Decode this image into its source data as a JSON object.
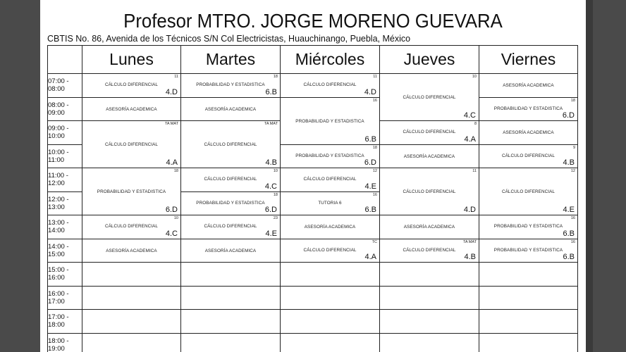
{
  "title": "Profesor MTRO. JORGE MORENO GUEVARA",
  "address": "CBTIS No. 86, Avenida de los Técnicos S/N Col Electricistas, Huauchinango, Puebla, México",
  "days": [
    "Lunes",
    "Martes",
    "Miércoles",
    "Jueves",
    "Viernes"
  ],
  "times": [
    "07:00 - 08:00",
    "08:00 - 09:00",
    "09:00 - 10:00",
    "10:00 - 11:00",
    "11:00 - 12:00",
    "12:00 - 13:00",
    "13:00 - 14:00",
    "14:00 - 15:00",
    "15:00 - 16:00",
    "16:00 - 17:00",
    "17:00 - 18:00",
    "18:00 - 19:00"
  ],
  "grid": [
    [
      {
        "room": "11",
        "subject": "CÁLCULO DIFERENCIAL",
        "group": "4.D",
        "span": 1
      },
      {
        "room": "",
        "subject": "ASESORÍA ACADEMICA",
        "group": "",
        "span": 1
      },
      {
        "room": "TA MAT",
        "subject": "CÁLCULO DIFERENCIAL",
        "group": "4.A",
        "span": 2
      },
      null,
      {
        "room": "18",
        "subject": "PROBABILIDAD Y ESTADISTICA",
        "group": "6.D",
        "span": 2
      },
      null,
      {
        "room": "10",
        "subject": "CÁLCULO DIFERENCIAL",
        "group": "4.C",
        "span": 1
      },
      {
        "room": "",
        "subject": "ASESORÍA ACADEMICA",
        "group": "",
        "span": 1
      },
      {
        "span": 1
      },
      {
        "span": 1
      },
      {
        "span": 1
      },
      {
        "span": 1
      }
    ],
    [
      {
        "room": "18",
        "subject": "PROBABILIDAD Y ESTADISTICA",
        "group": "6.B",
        "span": 1
      },
      {
        "room": "",
        "subject": "ASESORÍA ACADEMICA",
        "group": "",
        "span": 1
      },
      {
        "room": "TA MAT",
        "subject": "CÁLCULO DIFERENCIAL",
        "group": "4.B",
        "span": 2
      },
      null,
      {
        "room": "10",
        "subject": "CÁLCULO DIFERENCIAL",
        "group": "4.C",
        "span": 1
      },
      {
        "room": "18",
        "subject": "PROBABILIDAD Y ESTADISTICA",
        "group": "6.D",
        "span": 1
      },
      {
        "room": "23",
        "subject": "CÁLCULO DIFERENCIAL",
        "group": "4.E",
        "span": 1
      },
      {
        "room": "",
        "subject": "ASESORÍA ACADEMICA",
        "group": "",
        "span": 1
      },
      {
        "span": 1
      },
      {
        "span": 1
      },
      {
        "span": 1
      },
      {
        "span": 1
      }
    ],
    [
      {
        "room": "11",
        "subject": "CÁLCULO DIFERENCIAL",
        "group": "4.D",
        "span": 1
      },
      {
        "room": "16",
        "subject": "PROBABILIDAD Y ESTADISTICA",
        "group": "6.B",
        "span": 2
      },
      null,
      {
        "room": "18",
        "subject": "PROBABILIDAD Y ESTADISTICA",
        "group": "6.D",
        "span": 1
      },
      {
        "room": "12",
        "subject": "CÁLCULO DIFERENCIAL",
        "group": "4.E",
        "span": 1
      },
      {
        "room": "16",
        "subject": "TUTORIA 6",
        "group": "6.B",
        "span": 1
      },
      {
        "room": "",
        "subject": "ASESORÍA ACADEMICA",
        "group": "",
        "span": 1
      },
      {
        "room": "TC",
        "subject": "CÁLCULO DIFERENCIAL",
        "group": "4.A",
        "span": 1
      },
      {
        "span": 1
      },
      {
        "span": 1
      },
      {
        "span": 1
      },
      {
        "span": 1
      }
    ],
    [
      {
        "room": "10",
        "subject": "CÁLCULO DIFERENCIAL",
        "group": "4.C",
        "span": 2
      },
      null,
      {
        "room": "8",
        "subject": "CÁLCULO DIFERENCIAL",
        "group": "4.A",
        "span": 1
      },
      {
        "room": "",
        "subject": "ASESORÍA ACADEMICA",
        "group": "",
        "span": 1
      },
      {
        "room": "11",
        "subject": "CÁLCULO DIFERENCIAL",
        "group": "4.D",
        "span": 2
      },
      null,
      {
        "room": "",
        "subject": "ASESORÍA ACADEMICA",
        "group": "",
        "span": 1
      },
      {
        "room": "TA MAT",
        "subject": "CÁLCULO DIFERENCIAL",
        "group": "4.B",
        "span": 1
      },
      {
        "span": 1
      },
      {
        "span": 1
      },
      {
        "span": 1
      },
      {
        "span": 1
      }
    ],
    [
      {
        "room": "",
        "subject": "ASESORÍA ACADEMICA",
        "group": "",
        "span": 1
      },
      {
        "room": "18",
        "subject": "PROBABILIDAD Y ESTADISTICA",
        "group": "6.D",
        "span": 1
      },
      {
        "room": "",
        "subject": "ASESORÍA ACADEMICA",
        "group": "",
        "span": 1
      },
      {
        "room": "9",
        "subject": "CÁLCULO DIFERENCIAL",
        "group": "4.B",
        "span": 1
      },
      {
        "room": "12",
        "subject": "CÁLCULO DIFERENCIAL",
        "group": "4.E",
        "span": 2
      },
      null,
      {
        "room": "16",
        "subject": "PROBABILIDAD Y ESTADISTICA",
        "group": "6.B",
        "span": 1
      },
      {
        "room": "16",
        "subject": "PROBABILIDAD Y ESTADISTICA",
        "group": "6.B",
        "span": 1
      },
      {
        "span": 1
      },
      {
        "span": 1
      },
      {
        "span": 1
      },
      {
        "span": 1
      }
    ]
  ]
}
